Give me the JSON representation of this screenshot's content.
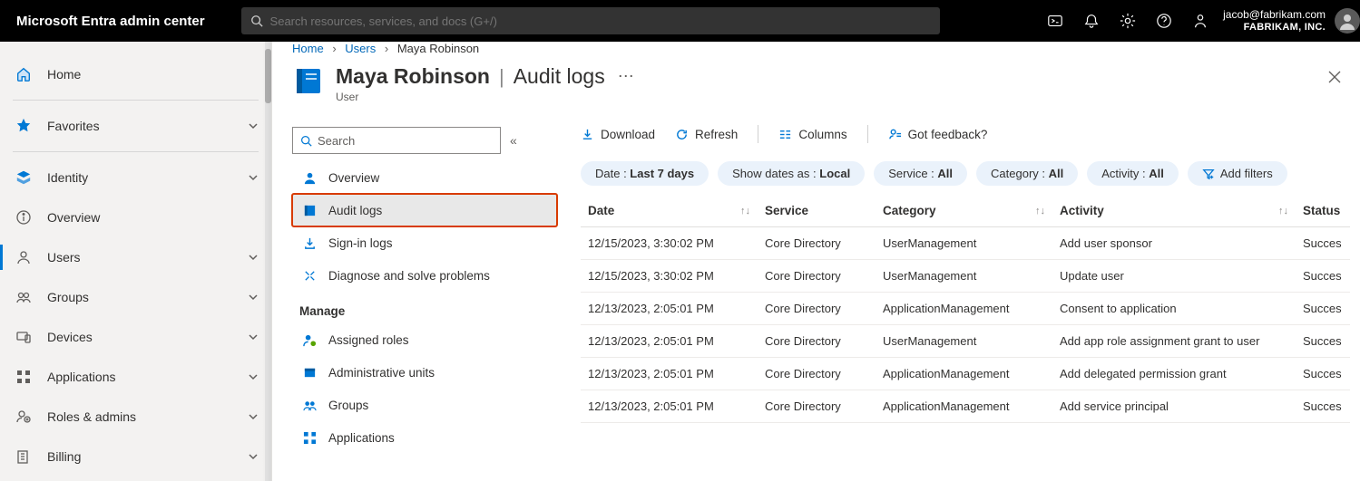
{
  "brand": "Microsoft Entra admin center",
  "search_placeholder": "Search resources, services, and docs (G+/)",
  "user": {
    "email": "jacob@fabrikam.com",
    "tenant": "FABRIKAM, INC."
  },
  "nav": {
    "home": "Home",
    "favorites": "Favorites",
    "identity": "Identity",
    "overview": "Overview",
    "users": "Users",
    "groups": "Groups",
    "devices": "Devices",
    "applications": "Applications",
    "roles": "Roles & admins",
    "billing": "Billing"
  },
  "breadcrumb": {
    "home": "Home",
    "users": "Users",
    "current": "Maya Robinson"
  },
  "page": {
    "title": "Maya Robinson",
    "section": "Audit logs",
    "type": "User",
    "search_placeholder": "Search"
  },
  "subnav": {
    "overview": "Overview",
    "audit": "Audit logs",
    "signin": "Sign-in logs",
    "diagnose": "Diagnose and solve problems",
    "manage": "Manage",
    "assigned_roles": "Assigned roles",
    "admin_units": "Administrative units",
    "groups": "Groups",
    "applications": "Applications"
  },
  "cmd": {
    "download": "Download",
    "refresh": "Refresh",
    "columns": "Columns",
    "feedback": "Got feedback?"
  },
  "filters": {
    "date_label": "Date : ",
    "date_value": "Last 7 days",
    "dates_as_label": "Show dates as : ",
    "dates_as_value": "Local",
    "service_label": "Service : ",
    "service_value": "All",
    "category_label": "Category : ",
    "category_value": "All",
    "activity_label": "Activity : ",
    "activity_value": "All",
    "add": "Add filters"
  },
  "columns": {
    "date": "Date",
    "service": "Service",
    "category": "Category",
    "activity": "Activity",
    "status": "Status"
  },
  "rows": [
    {
      "date": "12/15/2023, 3:30:02 PM",
      "service": "Core Directory",
      "category": "UserManagement",
      "activity": "Add user sponsor",
      "status": "Succes"
    },
    {
      "date": "12/15/2023, 3:30:02 PM",
      "service": "Core Directory",
      "category": "UserManagement",
      "activity": "Update user",
      "status": "Succes"
    },
    {
      "date": "12/13/2023, 2:05:01 PM",
      "service": "Core Directory",
      "category": "ApplicationManagement",
      "activity": "Consent to application",
      "status": "Succes"
    },
    {
      "date": "12/13/2023, 2:05:01 PM",
      "service": "Core Directory",
      "category": "UserManagement",
      "activity": "Add app role assignment grant to user",
      "status": "Succes"
    },
    {
      "date": "12/13/2023, 2:05:01 PM",
      "service": "Core Directory",
      "category": "ApplicationManagement",
      "activity": "Add delegated permission grant",
      "status": "Succes"
    },
    {
      "date": "12/13/2023, 2:05:01 PM",
      "service": "Core Directory",
      "category": "ApplicationManagement",
      "activity": "Add service principal",
      "status": "Succes"
    }
  ]
}
